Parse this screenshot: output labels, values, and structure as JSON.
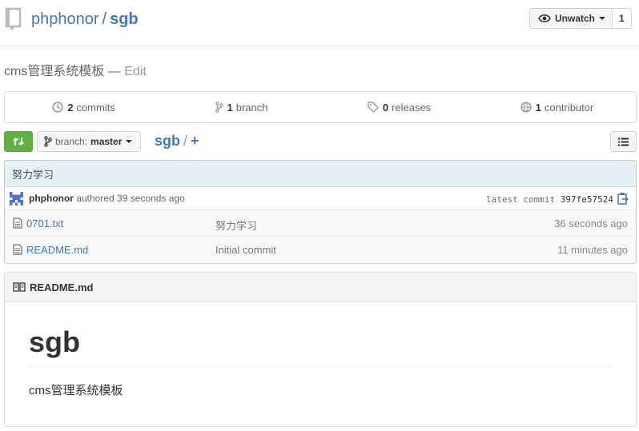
{
  "header": {
    "owner": "phphonor",
    "separator": "/",
    "repo": "sgb",
    "watch_label": "Unwatch",
    "watch_count": "1"
  },
  "description": {
    "text": "cms管理系统模板",
    "dash": "—",
    "edit_label": "Edit"
  },
  "summary": {
    "commits_count": "2",
    "commits_label": "commits",
    "branches_count": "1",
    "branches_label": "branch",
    "releases_count": "0",
    "releases_label": "releases",
    "contributors_count": "1",
    "contributors_label": "contributor"
  },
  "toolbar": {
    "branch_prefix": "branch:",
    "branch_name": "master",
    "breadcrumb_repo": "sgb",
    "breadcrumb_sep": "/",
    "breadcrumb_plus": "+"
  },
  "commit": {
    "message": "努力学习",
    "author": "phphonor",
    "authored_text": "authored 39 seconds ago",
    "latest_label": "latest commit",
    "sha": "397fe57524"
  },
  "files": [
    {
      "name": "0701.txt",
      "message": "努力学习",
      "age": "36 seconds ago"
    },
    {
      "name": "README.md",
      "message": "Initial commit",
      "age": "11 minutes ago"
    }
  ],
  "readme": {
    "header": "README.md",
    "heading": "sgb",
    "paragraph": "cms管理系统模板"
  },
  "colors": {
    "link": "#4078c0",
    "compare_green": "#60b044",
    "commit_bar": "#e6f1f6"
  }
}
